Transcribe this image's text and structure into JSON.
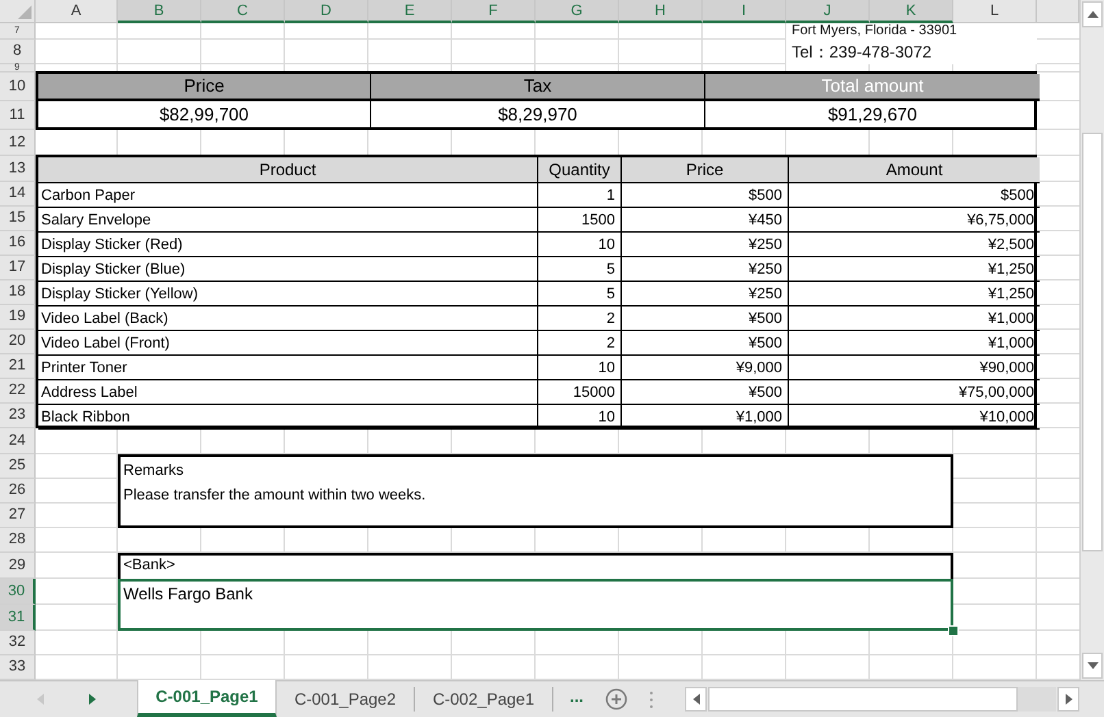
{
  "column_headers": [
    {
      "label": "A",
      "selected": false
    },
    {
      "label": "B",
      "selected": true
    },
    {
      "label": "C",
      "selected": true
    },
    {
      "label": "D",
      "selected": true
    },
    {
      "label": "E",
      "selected": true
    },
    {
      "label": "F",
      "selected": true
    },
    {
      "label": "G",
      "selected": true
    },
    {
      "label": "H",
      "selected": true
    },
    {
      "label": "I",
      "selected": true
    },
    {
      "label": "J",
      "selected": true
    },
    {
      "label": "K",
      "selected": true
    },
    {
      "label": "L",
      "selected": false
    }
  ],
  "row_headers": [
    {
      "label": "7",
      "selected": false
    },
    {
      "label": "8",
      "selected": false
    },
    {
      "label": "9",
      "selected": false
    },
    {
      "label": "10",
      "selected": false
    },
    {
      "label": "11",
      "selected": false
    },
    {
      "label": "12",
      "selected": false
    },
    {
      "label": "13",
      "selected": false
    },
    {
      "label": "14",
      "selected": false
    },
    {
      "label": "15",
      "selected": false
    },
    {
      "label": "16",
      "selected": false
    },
    {
      "label": "17",
      "selected": false
    },
    {
      "label": "18",
      "selected": false
    },
    {
      "label": "19",
      "selected": false
    },
    {
      "label": "20",
      "selected": false
    },
    {
      "label": "21",
      "selected": false
    },
    {
      "label": "22",
      "selected": false
    },
    {
      "label": "23",
      "selected": false
    },
    {
      "label": "24",
      "selected": false
    },
    {
      "label": "25",
      "selected": false
    },
    {
      "label": "26",
      "selected": false
    },
    {
      "label": "27",
      "selected": false
    },
    {
      "label": "28",
      "selected": false
    },
    {
      "label": "29",
      "selected": false
    },
    {
      "label": "30",
      "selected": true
    },
    {
      "label": "31",
      "selected": true
    },
    {
      "label": "32",
      "selected": false
    },
    {
      "label": "33",
      "selected": false
    }
  ],
  "address_lines": [
    "Fort Myers, Florida - 33901",
    "Tel：239-478-3072"
  ],
  "summary": [
    {
      "label": "Price",
      "value": "$82,99,700",
      "light_text": false
    },
    {
      "label": "Tax",
      "value": "$8,29,970",
      "light_text": false
    },
    {
      "label": "Total amount",
      "value": "$91,29,670",
      "light_text": true
    }
  ],
  "items": {
    "columns": [
      "Product",
      "Quantity",
      "Price",
      "Amount"
    ],
    "rows": [
      {
        "product": "Carbon Paper",
        "quantity": "1",
        "price": "$500",
        "amount": "$500"
      },
      {
        "product": "Salary Envelope",
        "quantity": "1500",
        "price": "¥450",
        "amount": "¥6,75,000"
      },
      {
        "product": "Display Sticker (Red)",
        "quantity": "10",
        "price": "¥250",
        "amount": "¥2,500"
      },
      {
        "product": "Display Sticker (Blue)",
        "quantity": "5",
        "price": "¥250",
        "amount": "¥1,250"
      },
      {
        "product": "Display Sticker (Yellow)",
        "quantity": "5",
        "price": "¥250",
        "amount": "¥1,250"
      },
      {
        "product": "Video Label (Back)",
        "quantity": "2",
        "price": "¥500",
        "amount": "¥1,000"
      },
      {
        "product": "Video Label (Front)",
        "quantity": "2",
        "price": "¥500",
        "amount": "¥1,000"
      },
      {
        "product": "Printer Toner",
        "quantity": "10",
        "price": "¥9,000",
        "amount": "¥90,000"
      },
      {
        "product": "Address Label",
        "quantity": "15000",
        "price": "¥500",
        "amount": "¥75,00,000"
      },
      {
        "product": "Black Ribbon",
        "quantity": "10",
        "price": "¥1,000",
        "amount": "¥10,000"
      }
    ]
  },
  "remarks": {
    "label": "Remarks",
    "text": "Please transfer the amount within two weeks."
  },
  "bank": {
    "label": "<Bank>",
    "value": "Wells Fargo Bank",
    "selected": true
  },
  "sheet_tabs": [
    {
      "label": "C-001_Page1",
      "selected": true
    },
    {
      "label": "C-001_Page2",
      "selected": false
    },
    {
      "label": "C-002_Page1",
      "selected": false
    }
  ],
  "more_tabs": "..."
}
